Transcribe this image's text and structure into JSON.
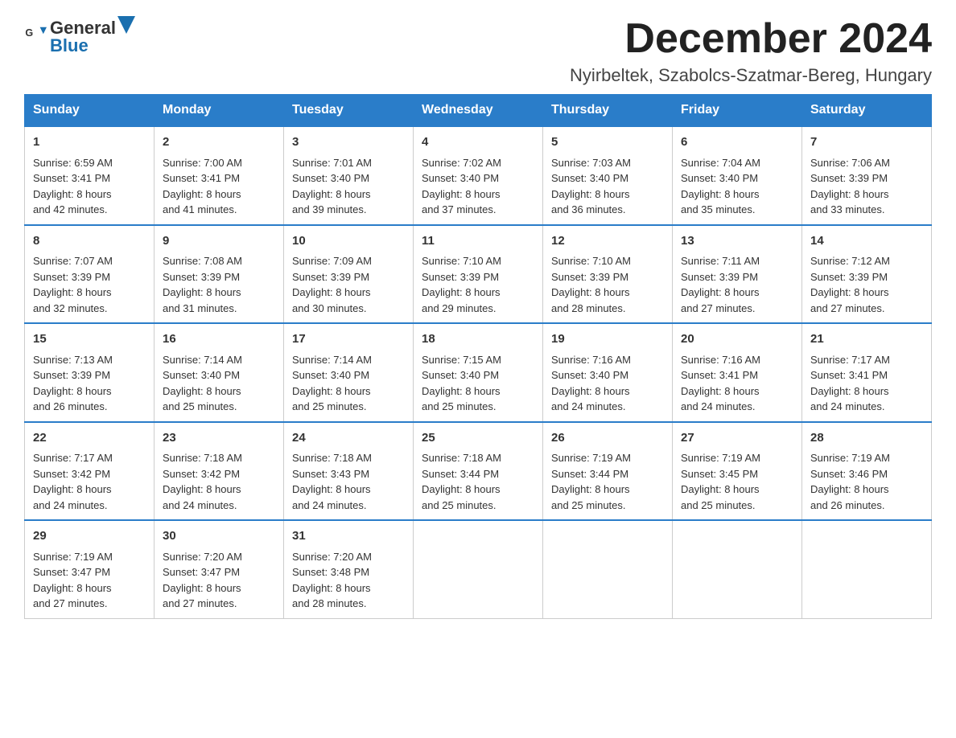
{
  "header": {
    "logo_general": "General",
    "logo_blue": "Blue",
    "month_title": "December 2024",
    "location": "Nyirbeltek, Szabolcs-Szatmar-Bereg, Hungary"
  },
  "days_of_week": [
    "Sunday",
    "Monday",
    "Tuesday",
    "Wednesday",
    "Thursday",
    "Friday",
    "Saturday"
  ],
  "weeks": [
    [
      {
        "day": "1",
        "info": "Sunrise: 6:59 AM\nSunset: 3:41 PM\nDaylight: 8 hours\nand 42 minutes."
      },
      {
        "day": "2",
        "info": "Sunrise: 7:00 AM\nSunset: 3:41 PM\nDaylight: 8 hours\nand 41 minutes."
      },
      {
        "day": "3",
        "info": "Sunrise: 7:01 AM\nSunset: 3:40 PM\nDaylight: 8 hours\nand 39 minutes."
      },
      {
        "day": "4",
        "info": "Sunrise: 7:02 AM\nSunset: 3:40 PM\nDaylight: 8 hours\nand 37 minutes."
      },
      {
        "day": "5",
        "info": "Sunrise: 7:03 AM\nSunset: 3:40 PM\nDaylight: 8 hours\nand 36 minutes."
      },
      {
        "day": "6",
        "info": "Sunrise: 7:04 AM\nSunset: 3:40 PM\nDaylight: 8 hours\nand 35 minutes."
      },
      {
        "day": "7",
        "info": "Sunrise: 7:06 AM\nSunset: 3:39 PM\nDaylight: 8 hours\nand 33 minutes."
      }
    ],
    [
      {
        "day": "8",
        "info": "Sunrise: 7:07 AM\nSunset: 3:39 PM\nDaylight: 8 hours\nand 32 minutes."
      },
      {
        "day": "9",
        "info": "Sunrise: 7:08 AM\nSunset: 3:39 PM\nDaylight: 8 hours\nand 31 minutes."
      },
      {
        "day": "10",
        "info": "Sunrise: 7:09 AM\nSunset: 3:39 PM\nDaylight: 8 hours\nand 30 minutes."
      },
      {
        "day": "11",
        "info": "Sunrise: 7:10 AM\nSunset: 3:39 PM\nDaylight: 8 hours\nand 29 minutes."
      },
      {
        "day": "12",
        "info": "Sunrise: 7:10 AM\nSunset: 3:39 PM\nDaylight: 8 hours\nand 28 minutes."
      },
      {
        "day": "13",
        "info": "Sunrise: 7:11 AM\nSunset: 3:39 PM\nDaylight: 8 hours\nand 27 minutes."
      },
      {
        "day": "14",
        "info": "Sunrise: 7:12 AM\nSunset: 3:39 PM\nDaylight: 8 hours\nand 27 minutes."
      }
    ],
    [
      {
        "day": "15",
        "info": "Sunrise: 7:13 AM\nSunset: 3:39 PM\nDaylight: 8 hours\nand 26 minutes."
      },
      {
        "day": "16",
        "info": "Sunrise: 7:14 AM\nSunset: 3:40 PM\nDaylight: 8 hours\nand 25 minutes."
      },
      {
        "day": "17",
        "info": "Sunrise: 7:14 AM\nSunset: 3:40 PM\nDaylight: 8 hours\nand 25 minutes."
      },
      {
        "day": "18",
        "info": "Sunrise: 7:15 AM\nSunset: 3:40 PM\nDaylight: 8 hours\nand 25 minutes."
      },
      {
        "day": "19",
        "info": "Sunrise: 7:16 AM\nSunset: 3:40 PM\nDaylight: 8 hours\nand 24 minutes."
      },
      {
        "day": "20",
        "info": "Sunrise: 7:16 AM\nSunset: 3:41 PM\nDaylight: 8 hours\nand 24 minutes."
      },
      {
        "day": "21",
        "info": "Sunrise: 7:17 AM\nSunset: 3:41 PM\nDaylight: 8 hours\nand 24 minutes."
      }
    ],
    [
      {
        "day": "22",
        "info": "Sunrise: 7:17 AM\nSunset: 3:42 PM\nDaylight: 8 hours\nand 24 minutes."
      },
      {
        "day": "23",
        "info": "Sunrise: 7:18 AM\nSunset: 3:42 PM\nDaylight: 8 hours\nand 24 minutes."
      },
      {
        "day": "24",
        "info": "Sunrise: 7:18 AM\nSunset: 3:43 PM\nDaylight: 8 hours\nand 24 minutes."
      },
      {
        "day": "25",
        "info": "Sunrise: 7:18 AM\nSunset: 3:44 PM\nDaylight: 8 hours\nand 25 minutes."
      },
      {
        "day": "26",
        "info": "Sunrise: 7:19 AM\nSunset: 3:44 PM\nDaylight: 8 hours\nand 25 minutes."
      },
      {
        "day": "27",
        "info": "Sunrise: 7:19 AM\nSunset: 3:45 PM\nDaylight: 8 hours\nand 25 minutes."
      },
      {
        "day": "28",
        "info": "Sunrise: 7:19 AM\nSunset: 3:46 PM\nDaylight: 8 hours\nand 26 minutes."
      }
    ],
    [
      {
        "day": "29",
        "info": "Sunrise: 7:19 AM\nSunset: 3:47 PM\nDaylight: 8 hours\nand 27 minutes."
      },
      {
        "day": "30",
        "info": "Sunrise: 7:20 AM\nSunset: 3:47 PM\nDaylight: 8 hours\nand 27 minutes."
      },
      {
        "day": "31",
        "info": "Sunrise: 7:20 AM\nSunset: 3:48 PM\nDaylight: 8 hours\nand 28 minutes."
      },
      {
        "day": "",
        "info": ""
      },
      {
        "day": "",
        "info": ""
      },
      {
        "day": "",
        "info": ""
      },
      {
        "day": "",
        "info": ""
      }
    ]
  ]
}
